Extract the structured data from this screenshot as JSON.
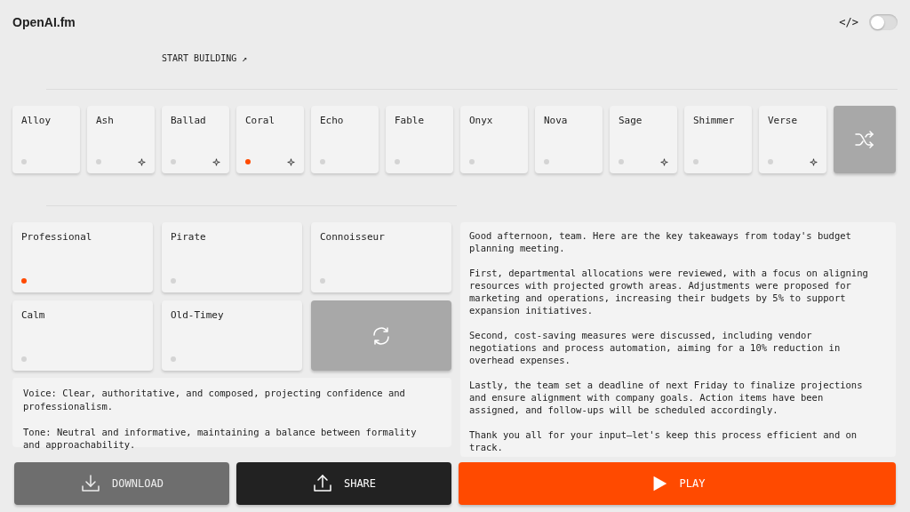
{
  "header": {
    "logo": "OpenAI.fm",
    "code_icon": "</>",
    "toggle": {
      "on": false
    }
  },
  "start_link": "START BUILDING ↗",
  "voices": [
    {
      "name": "Alloy",
      "selected": false,
      "starred": false
    },
    {
      "name": "Ash",
      "selected": false,
      "starred": true
    },
    {
      "name": "Ballad",
      "selected": false,
      "starred": true
    },
    {
      "name": "Coral",
      "selected": true,
      "starred": true
    },
    {
      "name": "Echo",
      "selected": false,
      "starred": false
    },
    {
      "name": "Fable",
      "selected": false,
      "starred": false
    },
    {
      "name": "Onyx",
      "selected": false,
      "starred": false
    },
    {
      "name": "Nova",
      "selected": false,
      "starred": false
    },
    {
      "name": "Sage",
      "selected": false,
      "starred": true
    },
    {
      "name": "Shimmer",
      "selected": false,
      "starred": false
    },
    {
      "name": "Verse",
      "selected": false,
      "starred": true
    }
  ],
  "vibes": [
    {
      "name": "Professional",
      "selected": true
    },
    {
      "name": "Pirate",
      "selected": false
    },
    {
      "name": "Connoisseur",
      "selected": false
    },
    {
      "name": "Calm",
      "selected": false
    },
    {
      "name": "Old-Timey",
      "selected": false
    }
  ],
  "instructions": [
    "Voice: Clear, authoritative, and composed, projecting confidence and professionalism.",
    "Tone: Neutral and informative, maintaining a balance between formality and approachability."
  ],
  "script": [
    "Good afternoon, team. Here are the key takeaways from today's budget planning meeting.",
    "First, departmental allocations were reviewed, with a focus on aligning resources with projected growth areas. Adjustments were proposed for marketing and operations, increasing their budgets by 5% to support expansion initiatives.",
    "Second, cost-saving measures were discussed, including vendor negotiations and process automation, aiming for a 10% reduction in overhead expenses.",
    "Lastly, the team set a deadline of next Friday to finalize projections and ensure alignment with company goals. Action items have been assigned, and follow-ups will be scheduled accordingly.",
    "Thank you all for your input—let's keep this process efficient and on track."
  ],
  "actions": [
    {
      "kind": "download",
      "label": "DOWNLOAD"
    },
    {
      "kind": "share",
      "label": "SHARE"
    },
    {
      "kind": "play",
      "label": "PLAY"
    }
  ]
}
